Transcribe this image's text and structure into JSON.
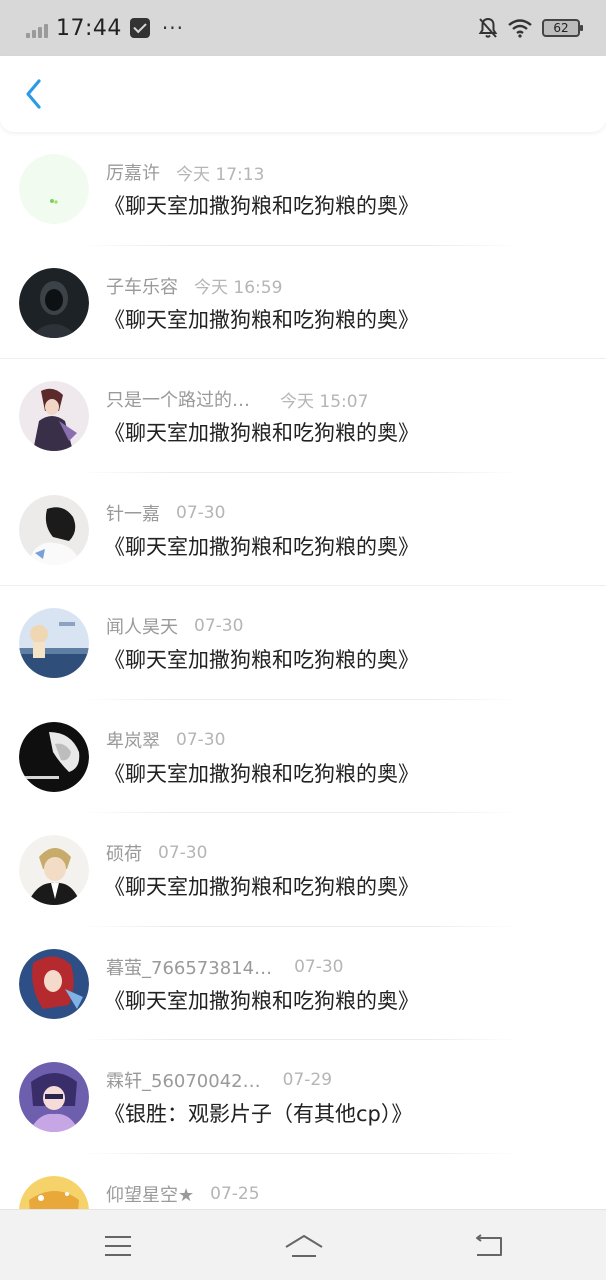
{
  "status_bar": {
    "time": "17:44",
    "more": "···",
    "battery": "62"
  },
  "header": {
    "back_icon": "chevron-left-icon",
    "accent_color": "#2d9ae8"
  },
  "list": {
    "items": [
      {
        "name": "厉嘉许",
        "time": "今天 17:13",
        "title": "《聊天室加撒狗粮和吃狗粮的奥》"
      },
      {
        "name": "子车乐容",
        "time": "今天 16:59",
        "title": "《聊天室加撒狗粮和吃狗粮的奥》"
      },
      {
        "name": "只是一个路过的…",
        "time": "今天 15:07",
        "title": "《聊天室加撒狗粮和吃狗粮的奥》"
      },
      {
        "name": "针一嘉",
        "time": "07-30",
        "title": "《聊天室加撒狗粮和吃狗粮的奥》"
      },
      {
        "name": "闻人昊天",
        "time": "07-30",
        "title": "《聊天室加撒狗粮和吃狗粮的奥》"
      },
      {
        "name": "卑岚翠",
        "time": "07-30",
        "title": "《聊天室加撒狗粮和吃狗粮的奥》"
      },
      {
        "name": "硕荷",
        "time": "07-30",
        "title": "《聊天室加撒狗粮和吃狗粮的奥》"
      },
      {
        "name": "暮萤_766573814…",
        "time": "07-30",
        "title": "《聊天室加撒狗粮和吃狗粮的奥》"
      },
      {
        "name": "霖轩_56070042…",
        "time": "07-29",
        "title": "《银胜：观影片子（有其他cp）》"
      },
      {
        "name": "仰望星空★",
        "time": "07-25",
        "title": ""
      }
    ]
  },
  "bottom_nav": {
    "menu_icon": "menu-icon",
    "home_icon": "home-icon",
    "back_icon": "back-icon"
  }
}
